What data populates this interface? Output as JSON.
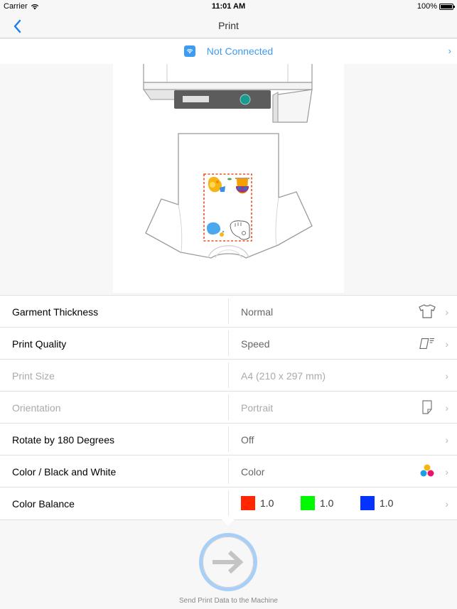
{
  "status_bar": {
    "carrier": "Carrier",
    "time": "11:01 AM",
    "battery": "100%"
  },
  "nav": {
    "title": "Print",
    "back_icon": "chevron-left-icon"
  },
  "connection": {
    "label": "Not Connected",
    "icon": "wifi-icon",
    "accent_color": "#3b9cf2"
  },
  "preview": {
    "description": "Printer platen with T-shirt and dashed print area containing four cartoon animal images",
    "print_area_border_color": "#f04e23"
  },
  "settings": [
    {
      "label": "Garment Thickness",
      "value": "Normal",
      "icon": "tshirt-icon",
      "enabled": true
    },
    {
      "label": "Print Quality",
      "value": "Speed",
      "icon": "print-speed-icon",
      "enabled": true
    },
    {
      "label": "Print Size",
      "value": "A4 (210 x 297 mm)",
      "icon": "",
      "enabled": false
    },
    {
      "label": "Orientation",
      "value": "Portrait",
      "icon": "portrait-page-icon",
      "enabled": false
    },
    {
      "label": "Rotate by 180 Degrees",
      "value": "Off",
      "icon": "",
      "enabled": true
    },
    {
      "label": "Color / Black and White",
      "value": "Color",
      "icon": "color-dots-icon",
      "enabled": true
    },
    {
      "label": "Color Balance",
      "value": "",
      "icon": "",
      "enabled": true
    }
  ],
  "color_balance": [
    {
      "channel": "red",
      "color": "#ff2600",
      "value": "1.0"
    },
    {
      "channel": "green",
      "color": "#00f900",
      "value": "1.0"
    },
    {
      "channel": "blue",
      "color": "#0433ff",
      "value": "1.0"
    }
  ],
  "send": {
    "label": "Send Print Data to the Machine",
    "icon": "arrow-right-icon",
    "ring_color": "#a8cff8"
  }
}
